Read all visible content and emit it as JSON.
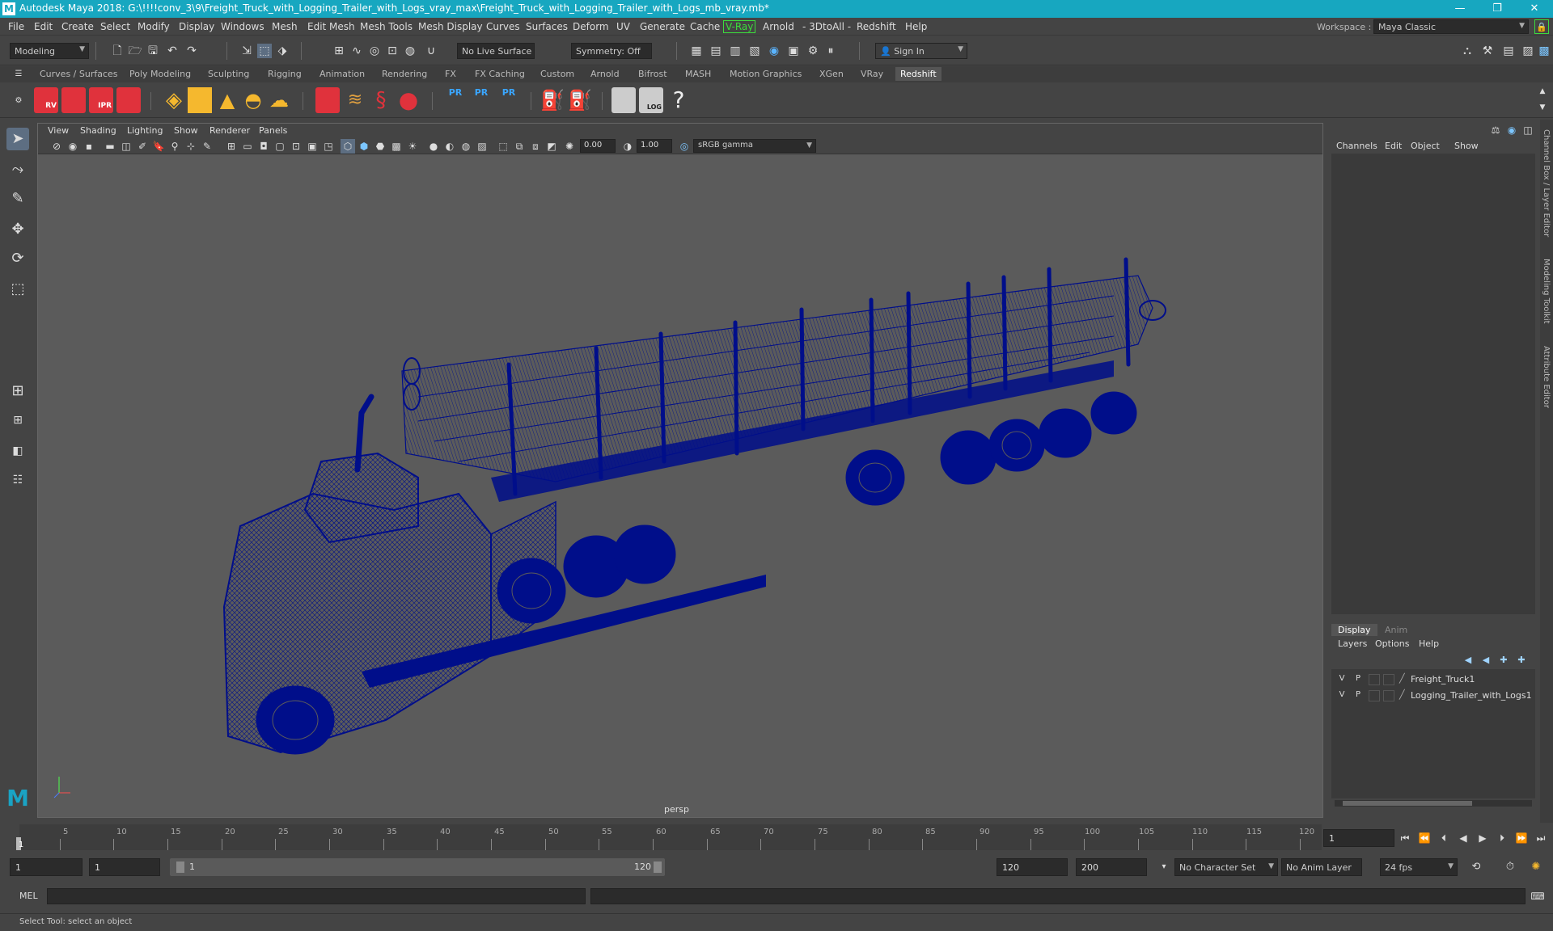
{
  "window": {
    "title": "Autodesk Maya 2018: G:\\!!!!conv_3\\9\\Freight_Truck_with_Logging_Trailer_with_Logs_vray_max\\Freight_Truck_with_Logging_Trailer_with_Logs_mb_vray.mb*",
    "minimize": "—",
    "maximize": "❐",
    "close": "✕"
  },
  "menubar": {
    "items": [
      "File",
      "Edit",
      "Create",
      "Select",
      "Modify",
      "Display",
      "Windows",
      "Mesh",
      "Edit Mesh",
      "Mesh Tools",
      "Mesh Display",
      "Curves",
      "Surfaces",
      "Deform",
      "UV",
      "Generate",
      "Cache",
      "V-Ray",
      "Arnold",
      "- 3DtoAll -",
      "Redshift",
      "Help"
    ],
    "workspace_label": "Workspace :",
    "workspace_value": "Maya Classic"
  },
  "toolbar": {
    "mode": "Modeling",
    "live_surface": "No Live Surface",
    "symmetry": "Symmetry: Off",
    "sign_in": "Sign In"
  },
  "shelf": {
    "tabs": [
      "Curves / Surfaces",
      "Poly Modeling",
      "Sculpting",
      "Rigging",
      "Animation",
      "Rendering",
      "FX",
      "FX Caching",
      "Custom",
      "Arnold",
      "Bifrost",
      "MASH",
      "Motion Graphics",
      "XGen",
      "VRay",
      "Redshift"
    ],
    "active_tab": "Redshift",
    "icon_labels": {
      "rv": "RV",
      "ipr": "IPR",
      "pr": "PR",
      "log": "LOG",
      "help": "?"
    }
  },
  "viewport": {
    "menus": [
      "View",
      "Shading",
      "Lighting",
      "Show",
      "Renderer",
      "Panels"
    ],
    "exposure": "0.00",
    "gamma": "1.00",
    "color_space": "sRGB gamma",
    "camera_label": "persp"
  },
  "channel_box": {
    "tabs": [
      "Channels",
      "Edit",
      "Object",
      "Show"
    ]
  },
  "layer_editor": {
    "tabs": [
      "Display",
      "Anim"
    ],
    "menus": [
      "Layers",
      "Options",
      "Help"
    ],
    "layers": [
      {
        "v": "V",
        "p": "P",
        "name": "Freight_Truck1"
      },
      {
        "v": "V",
        "p": "P",
        "name": "Logging_Trailer_with_Logs1"
      }
    ]
  },
  "side_tabs": [
    "Channel Box / Layer Editor",
    "Modeling Toolkit",
    "Attribute Editor"
  ],
  "timeline": {
    "ticks": [
      "5",
      "10",
      "15",
      "20",
      "25",
      "30",
      "35",
      "40",
      "45",
      "50",
      "55",
      "60",
      "65",
      "70",
      "75",
      "80",
      "85",
      "90",
      "95",
      "100",
      "105",
      "110",
      "115",
      "120"
    ],
    "start_label": "1",
    "current_frame": "1"
  },
  "range": {
    "start": "1",
    "playback_start": "1",
    "slider_start": "1",
    "slider_end": "120",
    "playback_end": "120",
    "end": "200",
    "character_set": "No Character Set",
    "anim_layer": "No Anim Layer",
    "fps": "24 fps"
  },
  "command_line": {
    "label": "MEL"
  },
  "status": {
    "text": "Select Tool: select an object"
  },
  "colors": {
    "titlebar": "#17a7c0",
    "wireframe": "#000e8a",
    "vray_accent": "#3cdc3c",
    "redshift_red": "#e0323c",
    "pr_blue": "#3aa6ff"
  }
}
